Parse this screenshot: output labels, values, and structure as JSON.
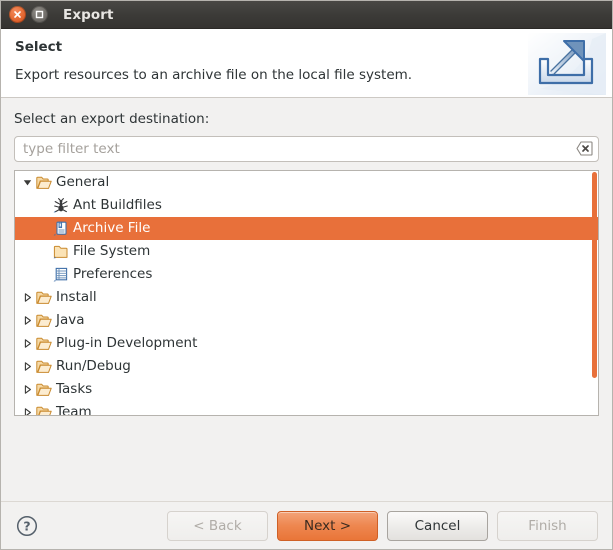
{
  "window": {
    "title": "Export",
    "close_icon": "close-icon",
    "maximize_icon": "maximize-icon"
  },
  "header": {
    "title": "Select",
    "description": "Export resources to an archive file on the local file system.",
    "icon": "export-wizard-icon"
  },
  "form": {
    "destination_label": "Select an export destination:",
    "filter_placeholder": "type filter text",
    "filter_value": "",
    "clear_icon": "clear-filter-icon"
  },
  "tree": {
    "items": [
      {
        "label": "General",
        "icon": "folder-open-icon",
        "depth": 0,
        "expander": "expanded",
        "selected": false
      },
      {
        "label": "Ant Buildfiles",
        "icon": "ant-icon",
        "depth": 1,
        "expander": "none",
        "selected": false
      },
      {
        "label": "Archive File",
        "icon": "archive-file-icon",
        "depth": 1,
        "expander": "none",
        "selected": true
      },
      {
        "label": "File System",
        "icon": "folder-icon",
        "depth": 1,
        "expander": "none",
        "selected": false
      },
      {
        "label": "Preferences",
        "icon": "preferences-icon",
        "depth": 1,
        "expander": "none",
        "selected": false
      },
      {
        "label": "Install",
        "icon": "folder-open-icon",
        "depth": 0,
        "expander": "collapsed",
        "selected": false
      },
      {
        "label": "Java",
        "icon": "folder-open-icon",
        "depth": 0,
        "expander": "collapsed",
        "selected": false
      },
      {
        "label": "Plug-in Development",
        "icon": "folder-open-icon",
        "depth": 0,
        "expander": "collapsed",
        "selected": false
      },
      {
        "label": "Run/Debug",
        "icon": "folder-open-icon",
        "depth": 0,
        "expander": "collapsed",
        "selected": false
      },
      {
        "label": "Tasks",
        "icon": "folder-open-icon",
        "depth": 0,
        "expander": "collapsed",
        "selected": false
      },
      {
        "label": "Team",
        "icon": "folder-open-icon",
        "depth": 0,
        "expander": "collapsed",
        "selected": false
      }
    ],
    "scrollbar": "vertical-scrollbar"
  },
  "footer": {
    "help_icon": "help-icon",
    "back_label": "< Back",
    "next_label": "Next >",
    "cancel_label": "Cancel",
    "finish_label": "Finish"
  },
  "colors": {
    "selection": "#e8703a",
    "default_button": "#ee8750",
    "titlebar": "#3c3b38",
    "body_background": "#f2f1f0"
  }
}
